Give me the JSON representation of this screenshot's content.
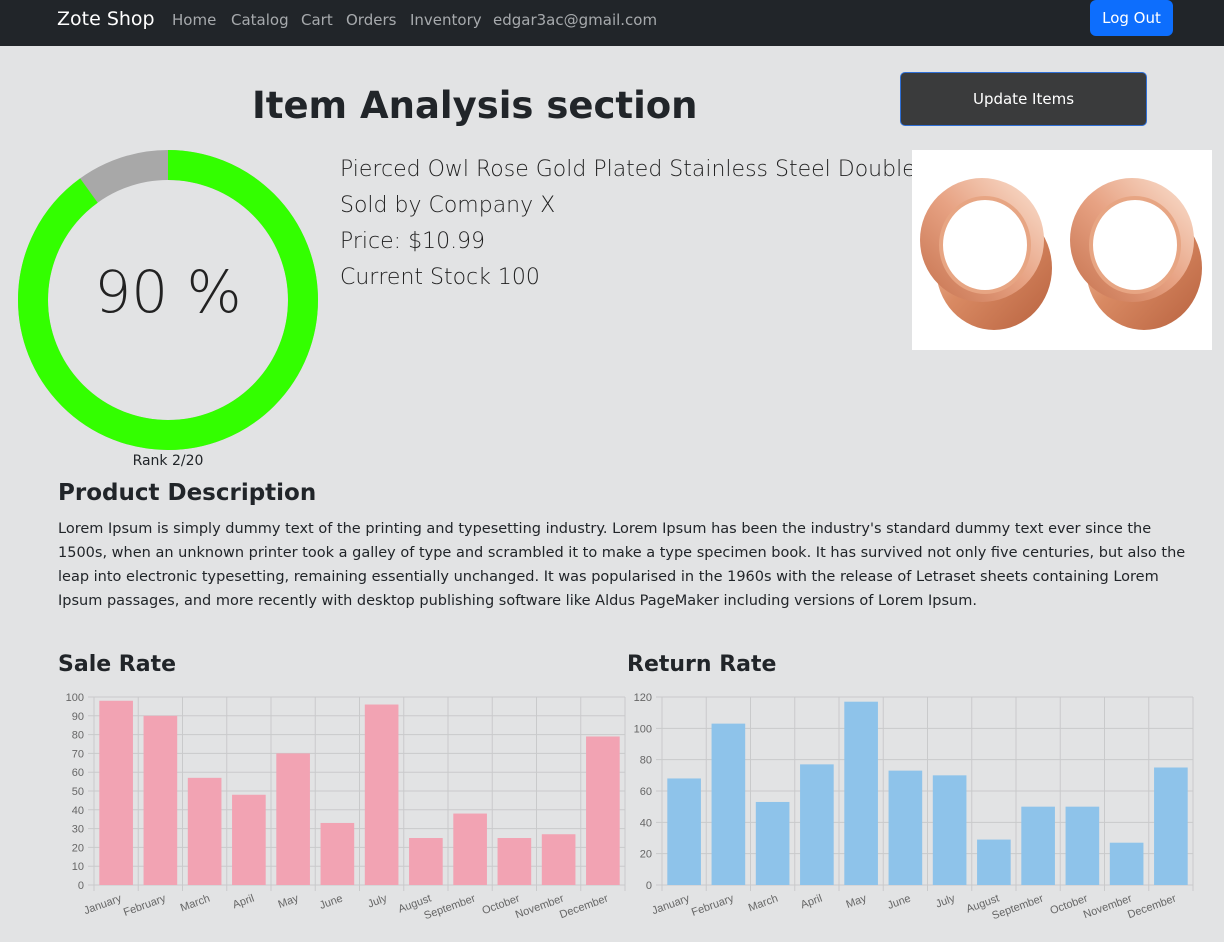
{
  "navbar": {
    "brand": "Zote Shop",
    "links": [
      "Home",
      "Catalog",
      "Cart",
      "Orders",
      "Inventory"
    ],
    "user_email": "edgar3ac@gmail.com",
    "logout_label": "Log Out"
  },
  "page": {
    "title": "Item Analysis section",
    "update_button_label": "Update Items"
  },
  "score": {
    "percent_text": "90 %",
    "value": 0.9,
    "rank_text": "Rank 2/20",
    "fill_color": "#33ff00",
    "track_color": "#a8a8a8"
  },
  "item": {
    "name": "Pierced Owl Rose Gold Plated Stainless Steel Double",
    "seller": "Sold by Company X",
    "price": "Price: $10.99",
    "stock": "Current Stock 100",
    "image": "rose-gold-ear-tunnels-image"
  },
  "description": {
    "title": "Product Description",
    "text": "Lorem Ipsum is simply dummy text of the printing and typesetting industry. Lorem Ipsum has been the industry's standard dummy text ever since the 1500s, when an unknown printer took a galley of type and scrambled it to make a type specimen book. It has survived not only five centuries, but also the leap into electronic typesetting, remaining essentially unchanged. It was popularised in the 1960s with the release of Letraset sheets containing Lorem Ipsum passages, and more recently with desktop publishing software like Aldus PageMaker including versions of Lorem Ipsum."
  },
  "chart_data": [
    {
      "type": "bar",
      "title": "Sale Rate",
      "categories": [
        "January",
        "February",
        "March",
        "April",
        "May",
        "June",
        "July",
        "August",
        "September",
        "October",
        "November",
        "December"
      ],
      "values": [
        98,
        90,
        57,
        48,
        70,
        33,
        96,
        25,
        38,
        25,
        27,
        79
      ],
      "ylim": [
        0,
        100
      ],
      "yticks": [
        0,
        10,
        20,
        30,
        40,
        50,
        60,
        70,
        80,
        90,
        100
      ],
      "color": "#f2a3b3",
      "grid": true
    },
    {
      "type": "bar",
      "title": "Return Rate",
      "categories": [
        "January",
        "February",
        "March",
        "April",
        "May",
        "June",
        "July",
        "August",
        "September",
        "October",
        "November",
        "December"
      ],
      "values": [
        68,
        103,
        53,
        77,
        117,
        73,
        70,
        29,
        50,
        50,
        27,
        75
      ],
      "ylim": [
        0,
        120
      ],
      "yticks": [
        0,
        20,
        40,
        60,
        80,
        100,
        120
      ],
      "color": "#8ec3ea",
      "grid": true
    }
  ]
}
